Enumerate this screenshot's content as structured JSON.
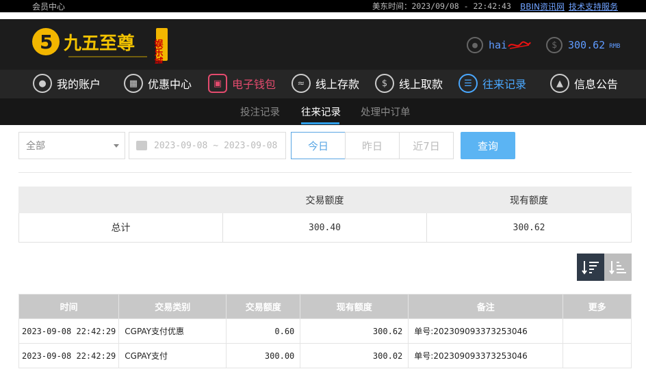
{
  "topbar": {
    "member_center": "会员中心",
    "time_label": "美东时间：",
    "time_value": "2023/09/08 - 22:42:43",
    "link_bbin": "BBIN资讯网",
    "link_support": "技术支持服务"
  },
  "header": {
    "logo_number": "5",
    "logo_text": "九五至尊",
    "logo_tag": "娱乐城",
    "username": "hai",
    "balance": "300.62",
    "currency": "RMB"
  },
  "nav": {
    "items": [
      {
        "label": "我的账户",
        "icon": "user-icon"
      },
      {
        "label": "优惠中心",
        "icon": "gift-icon"
      },
      {
        "label": "电子钱包",
        "icon": "wallet-icon"
      },
      {
        "label": "线上存款",
        "icon": "deposit-icon"
      },
      {
        "label": "线上取款",
        "icon": "withdraw-icon"
      },
      {
        "label": "往来记录",
        "icon": "record-icon"
      },
      {
        "label": "信息公告",
        "icon": "bell-icon"
      }
    ]
  },
  "subnav": {
    "tabs": [
      "投注记录",
      "往来记录",
      "处理中订单"
    ],
    "active": "往来记录"
  },
  "filters": {
    "type_select": "全部",
    "date_start": "2023-09-08",
    "date_sep": "~",
    "date_end": "2023-09-08",
    "quick": [
      "今日",
      "昨日",
      "近7日"
    ],
    "query_label": "查询"
  },
  "summary": {
    "headers": [
      "",
      "交易额度",
      "现有额度"
    ],
    "row": [
      "总计",
      "300.40",
      "300.62"
    ]
  },
  "table": {
    "headers": [
      "时间",
      "交易类别",
      "交易额度",
      "现有额度",
      "备注",
      "更多"
    ],
    "rows": [
      [
        "2023-09-08 22:42:29",
        "CGPAY支付优惠",
        "0.60",
        "300.62",
        "单号:202309093373253046",
        ""
      ],
      [
        "2023-09-08 22:42:29",
        "CGPAY支付",
        "300.00",
        "300.02",
        "单号:202309093373253046",
        ""
      ]
    ]
  }
}
